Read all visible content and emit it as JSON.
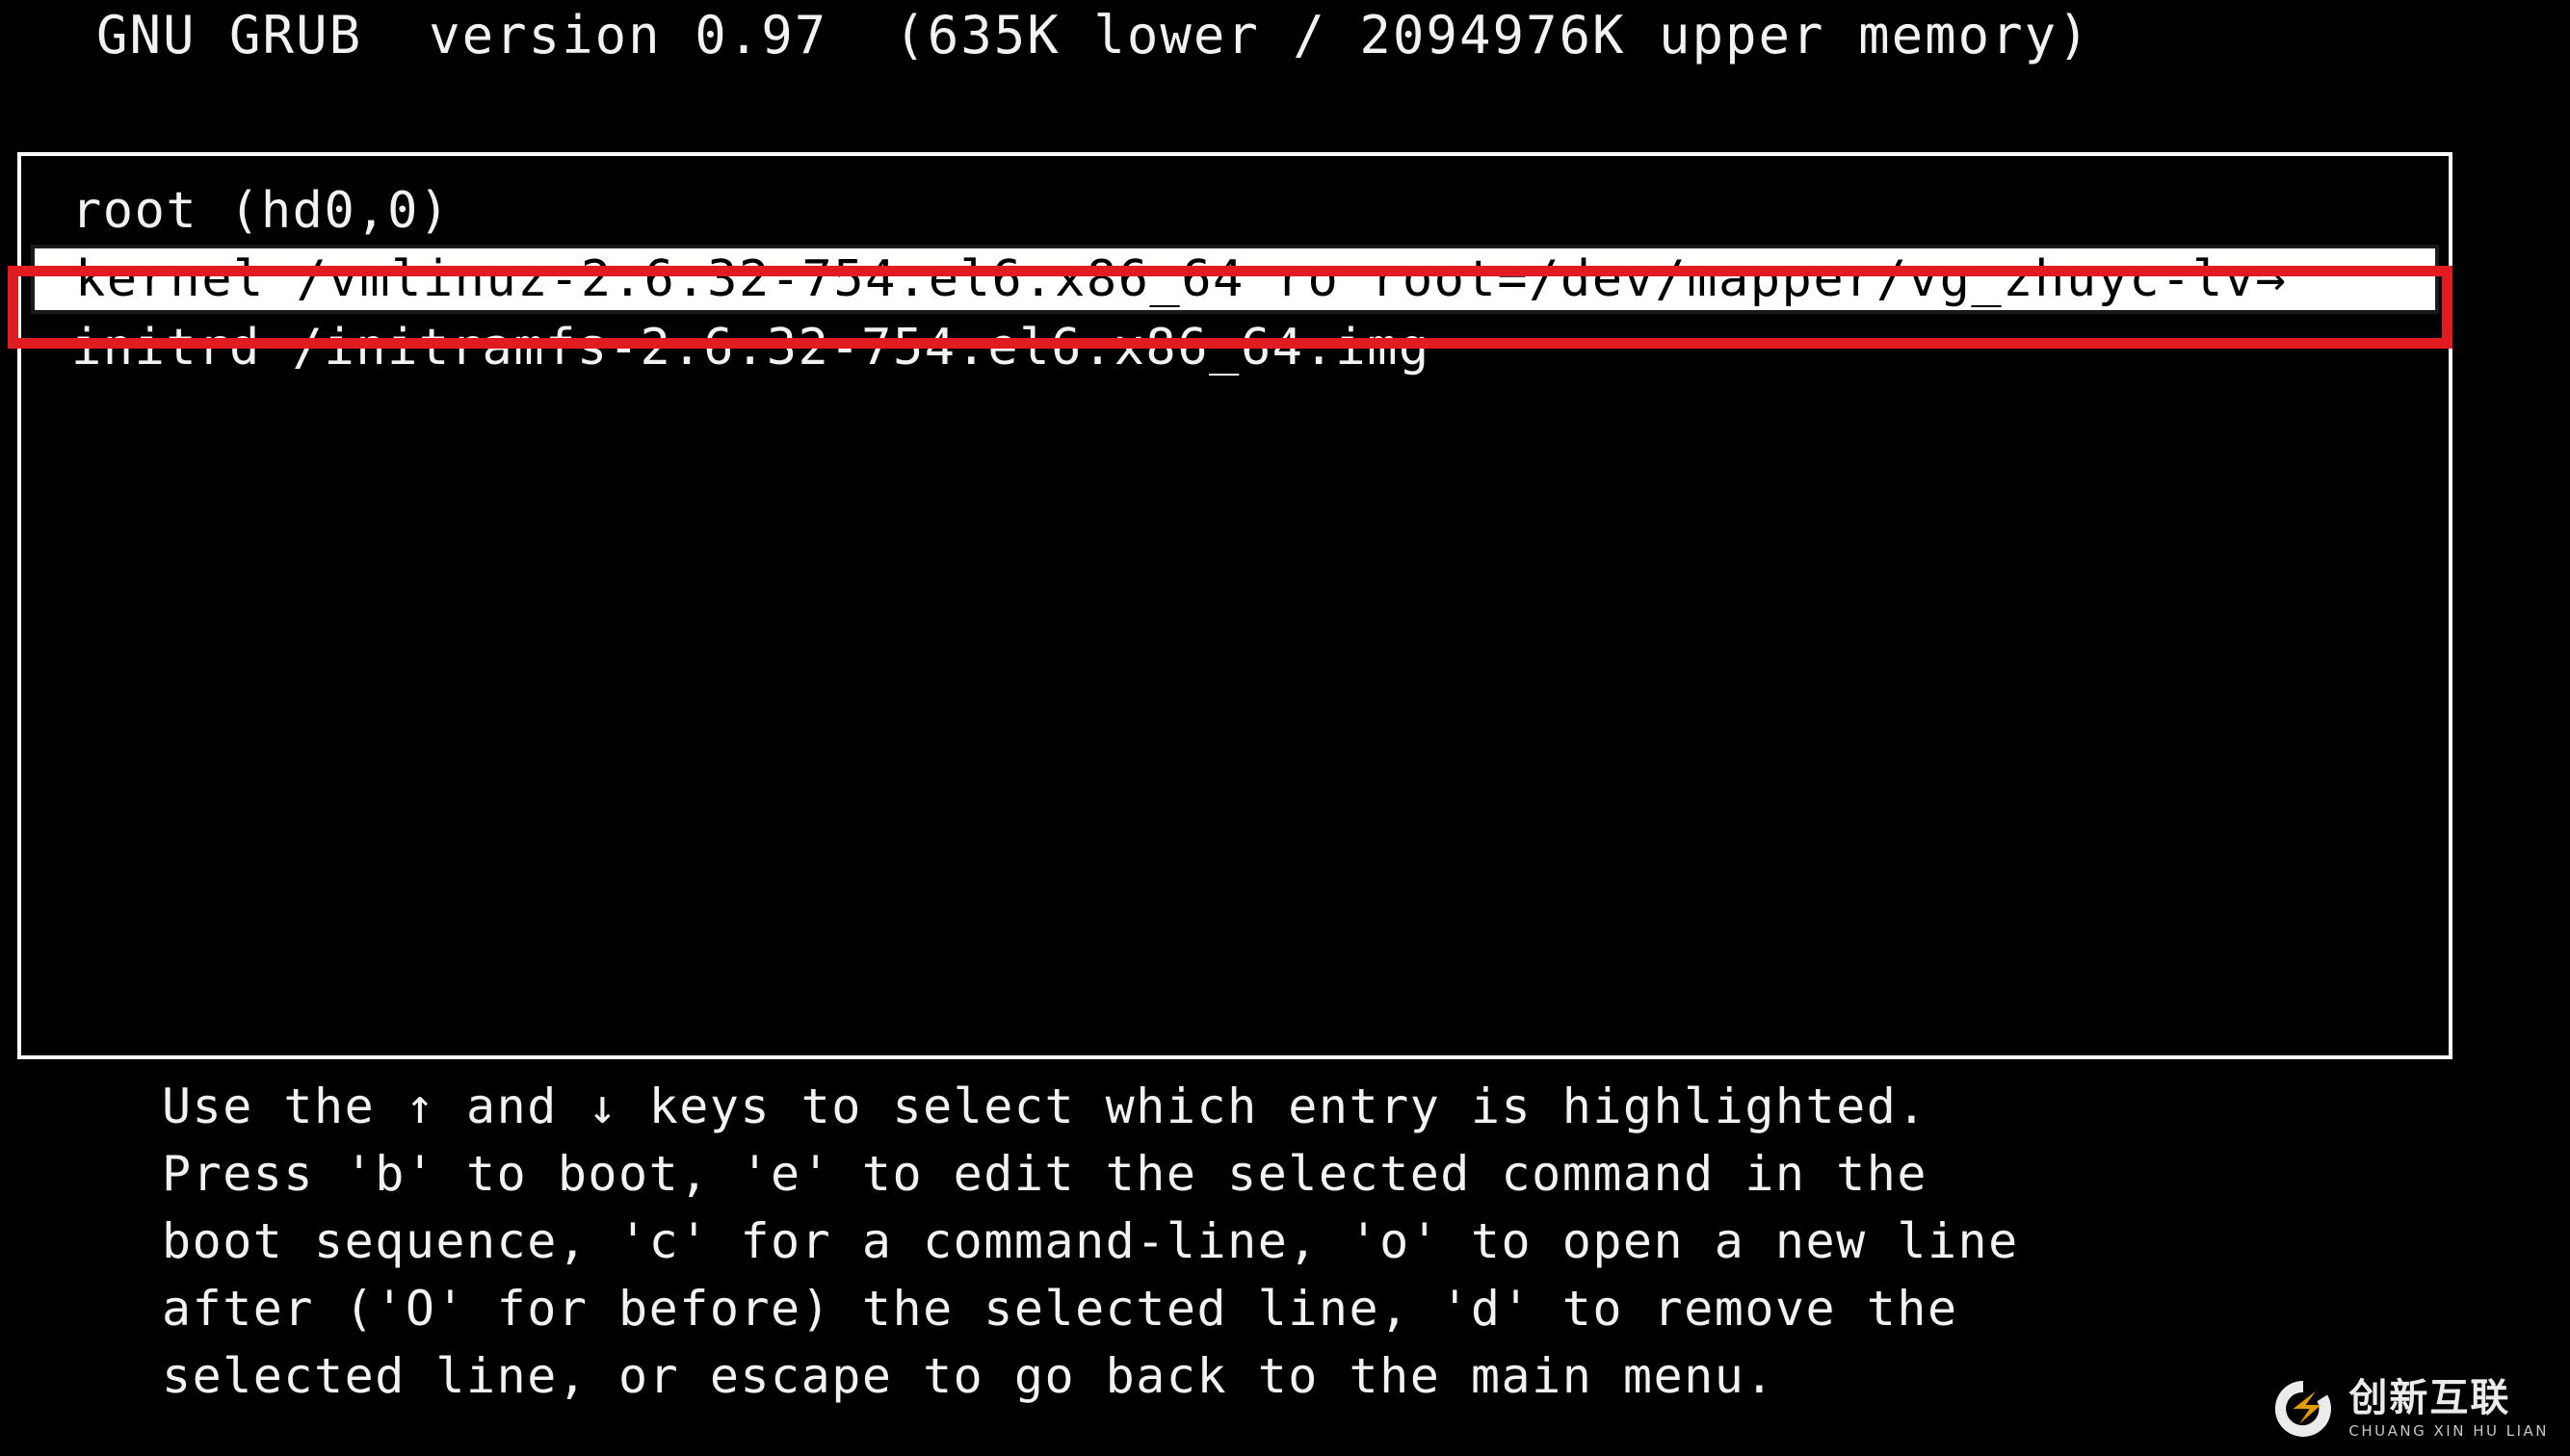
{
  "screen": {
    "background_color": "#000000",
    "foreground_color": "#ffffff"
  },
  "header": {
    "title": "GNU GRUB  version 0.97  (635K lower / 2094976K upper memory)",
    "program": "GNU GRUB",
    "version": "0.97",
    "lower_memory": "635K",
    "upper_memory": "2094976K"
  },
  "menu": {
    "entries": [
      {
        "text": "root (hd0,0)",
        "selected": false,
        "truncated": false
      },
      {
        "text": "kernel /vmlinuz-2.6.32-754.el6.x86_64 ro root=/dev/mapper/vg_zhuyc-lv→",
        "selected": true,
        "truncated": true
      },
      {
        "text": "initrd /initramfs-2.6.32-754.el6.x86_64.img",
        "selected": false,
        "truncated": false
      }
    ]
  },
  "annotation": {
    "color": "#e01b22",
    "target_entry_index": 1
  },
  "help": {
    "lines": [
      "Use the ↑ and ↓ keys to select which entry is highlighted.",
      "Press 'b' to boot, 'e' to edit the selected command in the",
      "boot sequence, 'c' for a command-line, 'o' to open a new line",
      "after ('O' for before) the selected line, 'd' to remove the",
      "selected line, or escape to go back to the main menu."
    ]
  },
  "watermark": {
    "chinese": "创新互联",
    "pinyin": "CHUANG XIN HU LIAN",
    "logo_icon": "chuangxin-circle-x-logo",
    "ring_color": "#ffffff",
    "bolt_color": "#f5a800"
  }
}
